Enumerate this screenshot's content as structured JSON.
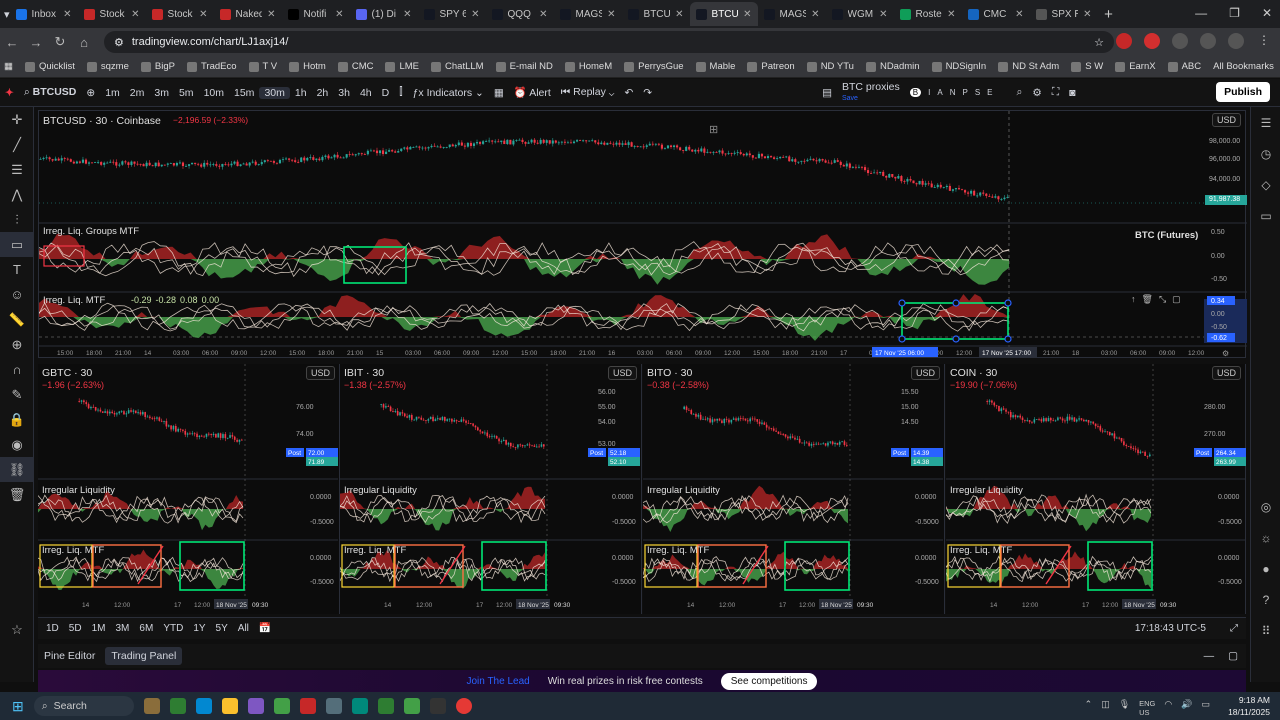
{
  "browser": {
    "tabs": [
      {
        "label": "Inbox",
        "color": "#1a73e8"
      },
      {
        "label": "Stock",
        "color": "#c62828"
      },
      {
        "label": "Stock",
        "color": "#c62828"
      },
      {
        "label": "Naked",
        "color": "#c62828"
      },
      {
        "label": "Notifi",
        "color": "#000000"
      },
      {
        "label": "(1) Di",
        "color": "#5865f2"
      },
      {
        "label": "SPY 6",
        "color": "#131722"
      },
      {
        "label": "QQQ",
        "color": "#131722"
      },
      {
        "label": "MAGS",
        "color": "#131722"
      },
      {
        "label": "BTCU",
        "color": "#131722"
      },
      {
        "label": "BTCU",
        "color": "#131722"
      },
      {
        "label": "MAGS",
        "color": "#131722"
      },
      {
        "label": "WGM",
        "color": "#131722"
      },
      {
        "label": "Roste",
        "color": "#0f9d58"
      },
      {
        "label": "CMC",
        "color": "#1565c0"
      },
      {
        "label": "SPX R",
        "color": "#555555"
      }
    ],
    "active_tab_index": 10,
    "url": "tradingview.com/chart/LJ1axj14/",
    "bookmarks": [
      "Quicklist",
      "sqzme",
      "BigP",
      "TradEco",
      "T V",
      "Hotm",
      "CMC",
      "LME",
      "ChatLLM",
      "E-mail ND",
      "HomeM",
      "PerrysGue",
      "Mable",
      "Patreon",
      "ND YTu",
      "NDadmin",
      "NDSignIn",
      "ND St Adm",
      "S W",
      "EarnX",
      "ABC"
    ],
    "all_bookmarks": "All Bookmarks"
  },
  "toolbar": {
    "symbol": "BTCUSD",
    "intervals": [
      "1m",
      "2m",
      "3m",
      "5m",
      "10m",
      "15m",
      "30m",
      "1h",
      "2h",
      "3h",
      "4h",
      "D"
    ],
    "selected_interval": "30m",
    "indicators": "Indicators",
    "alert": "Alert",
    "replay": "Replay",
    "layout_name": "BTC proxies",
    "layout_sub": "Save",
    "publish": "Publish"
  },
  "main_chart": {
    "title": "BTCUSD · 30 · Coinbase",
    "change": "−2,196.59 (−2.33%)",
    "currency": "USD",
    "price_ticks": [
      "98,000.00",
      "96,000.00",
      "94,000.00",
      "91,987.38"
    ],
    "last_price": "91,987.38",
    "pane1_label": "Irreg. Liq. Groups MTF",
    "pane1_ticks": [
      "0.50",
      "0.00",
      "-0.50"
    ],
    "pane2_label": "Irreg. Liq. MTF",
    "pane2_values": [
      "-0.29",
      "-0.28",
      "0.08",
      "0.00"
    ],
    "pane2_ticks": [
      "0.34",
      "0.00",
      "-0.50",
      "-0.62"
    ],
    "side_label": "BTC (Futures)",
    "time_ticks": [
      "15:00",
      "18:00",
      "21:00",
      "14",
      "03:00",
      "06:00",
      "09:00",
      "12:00",
      "15:00",
      "18:00",
      "21:00",
      "15",
      "03:00",
      "06:00",
      "09:00",
      "12:00",
      "15:00",
      "18:00",
      "21:00",
      "16",
      "03:00",
      "06:00",
      "09:00",
      "12:00",
      "15:00",
      "18:00",
      "21:00",
      "17",
      "03:00",
      "06:00",
      "09:00",
      "12:00",
      "15:00",
      "18:00",
      "21:00",
      "18",
      "03:00",
      "06:00",
      "09:00",
      "12:00"
    ],
    "cursor_time_left": "17 Nov '25  06:00",
    "cursor_time_right": "17 Nov '25  17:00"
  },
  "sub_charts": [
    {
      "title": "GBTC · 30",
      "change": "−1.96 (−2.63%)",
      "currency": "USD",
      "ticks": [
        "76.00",
        "74.00"
      ],
      "post_label": "Post",
      "post_value": "72.00",
      "last": "71.89",
      "liq_label": "Irregular Liquidity",
      "mtf_label": "Irreg. Liq. MTF",
      "osc_ticks": [
        "0.0000",
        "-0.5000"
      ],
      "times": [
        "14",
        "12:00",
        "17",
        "12:00"
      ],
      "date": "18 Nov '25",
      "time": "09:30"
    },
    {
      "title": "IBIT · 30",
      "change": "−1.38 (−2.57%)",
      "currency": "USD",
      "ticks": [
        "56.00",
        "55.00",
        "54.00",
        "53.00"
      ],
      "post_label": "Post",
      "post_value": "52.18",
      "last": "52.10",
      "liq_label": "Irregular Liquidity",
      "mtf_label": "Irreg. Liq. MTF",
      "osc_ticks": [
        "0.0000",
        "-0.5000"
      ],
      "times": [
        "14",
        "12:00",
        "17",
        "12:00"
      ],
      "date": "18 Nov '25",
      "time": "09:30"
    },
    {
      "title": "BITO · 30",
      "change": "−0.38 (−2.58%)",
      "currency": "USD",
      "ticks": [
        "15.50",
        "15.00",
        "14.50"
      ],
      "post_label": "Post",
      "post_value": "14.39",
      "last": "14.38",
      "liq_label": "Irregular Liquidity",
      "mtf_label": "Irreg. Liq. MTF",
      "osc_ticks": [
        "0.0000",
        "-0.5000"
      ],
      "times": [
        "14",
        "12:00",
        "17",
        "12:00"
      ],
      "date": "18 Nov '25",
      "time": "09:30"
    },
    {
      "title": "COIN · 30",
      "change": "−19.90 (−7.06%)",
      "currency": "USD",
      "ticks": [
        "280.00",
        "270.00"
      ],
      "post_label": "Post",
      "post_value": "264.34",
      "last": "263.99",
      "liq_label": "Irregular Liquidity",
      "mtf_label": "Irreg. Liq. MTF",
      "osc_ticks": [
        "0.0000",
        "-0.5000"
      ],
      "times": [
        "14",
        "12:00",
        "17",
        "12:00"
      ],
      "date": "18 Nov '25",
      "time": "09:30"
    }
  ],
  "ranges": [
    "1D",
    "5D",
    "1M",
    "3M",
    "6M",
    "YTD",
    "1Y",
    "5Y",
    "All"
  ],
  "clock": "17:18:43 UTC-5",
  "panels": {
    "pine": "Pine Editor",
    "trading": "Trading Panel"
  },
  "promo": {
    "text1": "Join The Lead",
    "text2": "Win real prizes in risk free contests",
    "button": "See competitions"
  },
  "taskbar": {
    "search": "Search",
    "lang": "ENG",
    "region": "US",
    "time": "9:18 AM",
    "date": "18/11/2025"
  },
  "colors": {
    "up": "#26a69a",
    "down": "#f23645",
    "osc_green": "#4caf50",
    "osc_red": "#c62828",
    "box_green": "#00e676",
    "box_orange": "#ff7043"
  }
}
